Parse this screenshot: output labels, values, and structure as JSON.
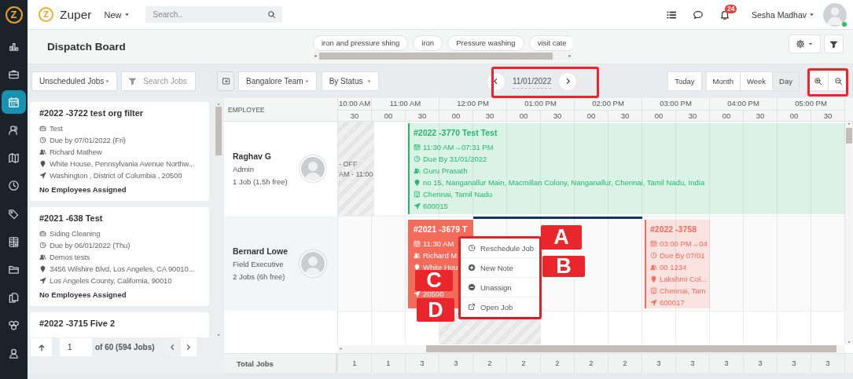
{
  "sidebar": {
    "logo": "Z",
    "items": [
      {
        "selected": false
      },
      {
        "selected": false
      },
      {
        "selected": true
      },
      {
        "selected": false
      },
      {
        "selected": false
      },
      {
        "selected": false
      },
      {
        "selected": false
      },
      {
        "selected": false
      },
      {
        "selected": false
      },
      {
        "selected": false
      },
      {
        "selected": false
      },
      {
        "selected": false
      }
    ]
  },
  "topbar": {
    "brand_mark": "Z",
    "brand": "Zuper",
    "new_menu": "New",
    "search": {
      "placeholder": "Search.."
    },
    "notifications": "24",
    "user": "Sesha Madhav",
    "online": true
  },
  "header": {
    "title": "Dispatch Board",
    "chips": [
      "iron and pressure shing",
      "iron",
      "Pressure washing",
      "visit cate"
    ]
  },
  "toolbar": {
    "job_filter": "Unscheduled Jobs",
    "job_search": {
      "placeholder": "Search Jobs"
    },
    "team": "Bangalore Team",
    "grouping": "By Status",
    "date": "11/01/2022",
    "today": "Today",
    "views": [
      {
        "label": "Month",
        "selected": false
      },
      {
        "label": "Week",
        "selected": false
      },
      {
        "label": "Day",
        "selected": true
      }
    ]
  },
  "unscheduled_jobs": [
    {
      "title": "#2022 -3722 test org filter",
      "lines": [
        {
          "kind": "service",
          "text": "Test"
        },
        {
          "kind": "due",
          "text": "Due by 07/01/2022 (Fri)"
        },
        {
          "kind": "team",
          "text": "Richard Mathew"
        },
        {
          "kind": "address",
          "text": "White House, Pennsylvania Avenue Northw..."
        },
        {
          "kind": "region",
          "text": "Washington , District of Columbia , 20500"
        }
      ],
      "assignment": "No Employees Assigned"
    },
    {
      "title": "#2021 -638 Test",
      "lines": [
        {
          "kind": "service",
          "text": "Siding Cleaning"
        },
        {
          "kind": "due",
          "text": "Due by 06/01/2022 (Thu)"
        },
        {
          "kind": "team",
          "text": "Demos tests"
        },
        {
          "kind": "address",
          "text": "3456 Wilshire Blvd, Los Angeles, CA 90010..."
        },
        {
          "kind": "region",
          "text": "Los Angeles County, California, 90010"
        }
      ],
      "assignment": "No Employees Assigned"
    },
    {
      "title": "#2022 -3715 Five 2"
    }
  ],
  "pagination": {
    "page": "1",
    "summary": "of 60 (594 Jobs)"
  },
  "schedule": {
    "employee_heading": "EMPLOYEE",
    "hours": [
      "10:00 AM",
      "11:00 AM",
      "12:00 PM",
      "01:00 PM",
      "02:00 PM",
      "03:00 PM",
      "04:00 PM",
      "05:00 PM"
    ],
    "minutes": [
      "30",
      "00",
      "30",
      "00",
      "30",
      "00",
      "30",
      "00",
      "30",
      "00",
      "30",
      "00",
      "30",
      "00",
      "30"
    ],
    "employees": [
      {
        "name": "Raghav G",
        "role": "Admin",
        "summary": "1 Job (1.5h free)"
      },
      {
        "name": "Bernard Lowe",
        "role": "Field Executive",
        "summary": "2 Jobs (6h free)"
      }
    ],
    "off_time": [
      "- OFF",
      "AM - 11:00"
    ],
    "jobs": [
      {
        "color": "#21b968",
        "selected": false,
        "title": "#2022 -3770 Test Test",
        "lines": [
          {
            "kind": "time",
            "text": "11:30 AM→07:31 PM"
          },
          {
            "kind": "due",
            "text": " Due By 31/01/2022"
          },
          {
            "kind": "team",
            "text": "Guru Prasath"
          },
          {
            "kind": "address",
            "text": "no 15, Nanganallur Main, Macmillan Colony, Nanganallur, Chennai, Tamil Nadu, India"
          },
          {
            "kind": "area",
            "text": "Chennai, Tamil Nadu"
          },
          {
            "kind": "region",
            "text": "600015"
          }
        ]
      },
      {
        "color": "#f26b5b",
        "selected": true,
        "title": "#2021 -3679 T",
        "lines": [
          {
            "kind": "time",
            "text": "11:30 AM"
          },
          {
            "kind": "team",
            "text": "Richard M"
          },
          {
            "kind": "address",
            "text": "White Hou"
          },
          {
            "kind": "region",
            "text": "20500"
          }
        ]
      },
      {
        "color": "#f26b5b",
        "selected": false,
        "title": "#2022 -3758",
        "lines": [
          {
            "kind": "time",
            "text": "03:00 PM→04"
          },
          {
            "kind": "due",
            "text": " Due By 07/01"
          },
          {
            "kind": "team",
            "text": "00 1234"
          },
          {
            "kind": "address",
            "text": "Lakshmi Col..."
          },
          {
            "kind": "area",
            "text": "Chennai, Tam"
          },
          {
            "kind": "region",
            "text": "600017"
          }
        ]
      }
    ],
    "context_menu": [
      {
        "kind": "reschedule",
        "label": "Reschedule Job"
      },
      {
        "kind": "note",
        "label": "New Note"
      },
      {
        "kind": "unassign",
        "label": "Unassign"
      },
      {
        "kind": "open",
        "label": "Open Job"
      }
    ],
    "totals_label": "Total Jobs",
    "totals": [
      "1",
      "1",
      "3",
      "3",
      "2",
      "2",
      "2",
      "2",
      "2",
      "3",
      "3",
      "3",
      "3",
      "3",
      "3"
    ]
  },
  "annotations": {
    "letters": [
      "A",
      "B",
      "C",
      "D"
    ]
  }
}
